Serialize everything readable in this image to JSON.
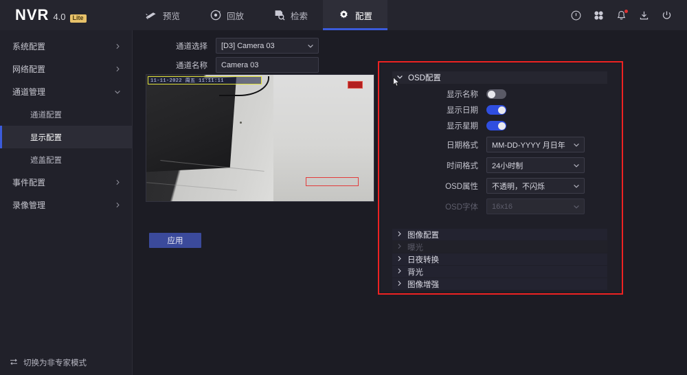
{
  "brand": {
    "name": "NVR",
    "version": "4.0",
    "badge": "Lite"
  },
  "nav": {
    "tabs": [
      {
        "label": "预览",
        "icon": "camera-icon",
        "active": false
      },
      {
        "label": "回放",
        "icon": "playback-icon",
        "active": false
      },
      {
        "label": "检索",
        "icon": "search-doc-icon",
        "active": false
      },
      {
        "label": "配置",
        "icon": "gear-icon",
        "active": true
      }
    ],
    "right_icons": [
      "info-icon",
      "apps-icon",
      "bell-icon",
      "download-icon",
      "power-icon"
    ]
  },
  "sidebar": {
    "items": [
      {
        "label": "系统配置",
        "type": "group",
        "expandable": true
      },
      {
        "label": "网络配置",
        "type": "group",
        "expandable": true
      },
      {
        "label": "通道管理",
        "type": "group",
        "expanded": true
      },
      {
        "label": "通道配置",
        "type": "sub"
      },
      {
        "label": "显示配置",
        "type": "sub",
        "selected": true
      },
      {
        "label": "遮盖配置",
        "type": "sub"
      },
      {
        "label": "事件配置",
        "type": "group",
        "expandable": true
      },
      {
        "label": "录像管理",
        "type": "group",
        "expandable": true
      }
    ],
    "footer": {
      "label": "切换为非专家模式",
      "icon": "switch-mode-icon"
    }
  },
  "main": {
    "channel_select": {
      "label": "通道选择",
      "value": "[D3] Camera 03"
    },
    "channel_name": {
      "label": "通道名称",
      "value": "Camera 03"
    },
    "apply_label": "应用",
    "preview": {
      "osd_overlay_text": "11-11-2022 周五 11:11:11",
      "osd_box_color": "#e3e33a",
      "annotation_box_color": "#e33a3a"
    }
  },
  "osd_panel": {
    "annotation_color": "#ee2222",
    "section_title": "OSD配置",
    "toggles": [
      {
        "label": "显示名称",
        "on": false
      },
      {
        "label": "显示日期",
        "on": true
      },
      {
        "label": "显示星期",
        "on": true
      }
    ],
    "selects": [
      {
        "label": "日期格式",
        "value": "MM-DD-YYYY 月日年",
        "disabled": false
      },
      {
        "label": "时间格式",
        "value": "24小时制",
        "disabled": false
      },
      {
        "label": "OSD属性",
        "value": "不透明，不闪烁",
        "disabled": false
      },
      {
        "label": "OSD字体",
        "value": "16x16",
        "disabled": true
      }
    ],
    "collapsed_sections": [
      {
        "label": "图像配置",
        "disabled": false
      },
      {
        "label": "曝光",
        "disabled": true
      },
      {
        "label": "日夜转换",
        "disabled": false
      },
      {
        "label": "背光",
        "disabled": false
      },
      {
        "label": "图像增强",
        "disabled": false
      }
    ]
  },
  "colors": {
    "accent": "#3b5bdb",
    "toggle_on": "#2f4ee0",
    "annotation": "#ee2222",
    "badge": "#e8c26a"
  }
}
